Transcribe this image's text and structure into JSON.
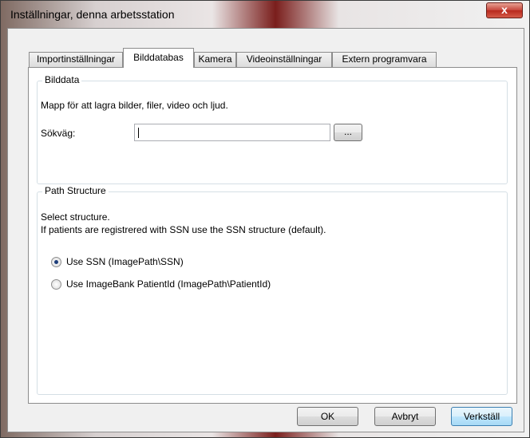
{
  "window": {
    "title": "Inställningar, denna arbetsstation",
    "close_label": "x"
  },
  "tabs": [
    {
      "label": "Importinställningar",
      "active": false
    },
    {
      "label": "Bilddatabas",
      "active": true
    },
    {
      "label": "Kamera",
      "active": false
    },
    {
      "label": "Videoinställningar",
      "active": false
    },
    {
      "label": "Extern programvara",
      "active": false
    }
  ],
  "bilddata": {
    "legend": "Bilddata",
    "description": "Mapp för att lagra bilder, filer, video och ljud.",
    "path_label": "Sökväg:",
    "path_value": "",
    "browse_label": "..."
  },
  "path_structure": {
    "legend": "Path Structure",
    "line1": "Select structure.",
    "line2": "If patients are registrered with SSN use the SSN structure (default).",
    "options": [
      {
        "label": "Use SSN (ImagePath\\SSN)",
        "selected": true
      },
      {
        "label": "Use ImageBank PatientId (ImagePath\\PatientId)",
        "selected": false
      }
    ]
  },
  "buttons": {
    "ok": "OK",
    "cancel": "Avbryt",
    "apply": "Verkställ"
  }
}
